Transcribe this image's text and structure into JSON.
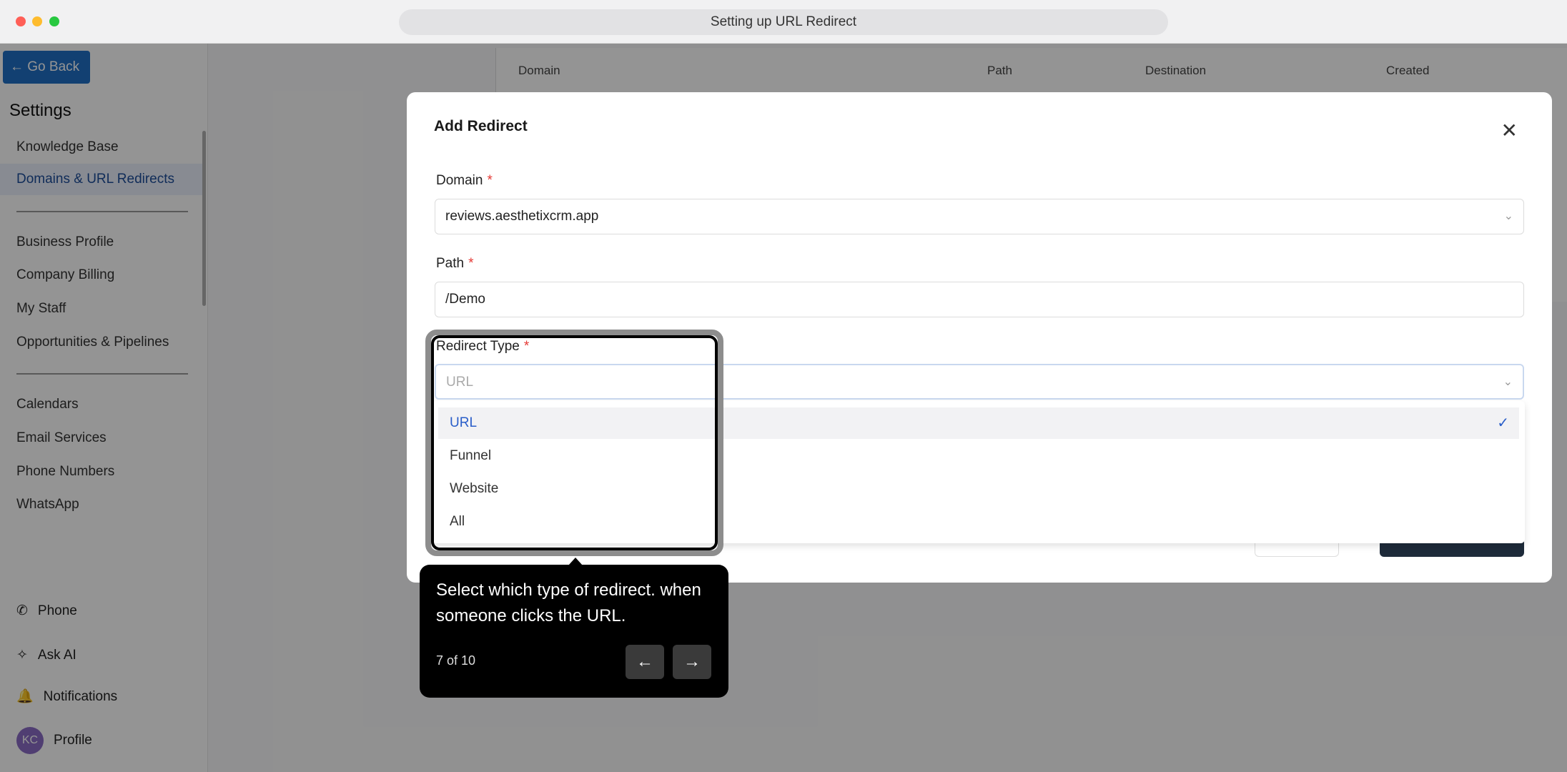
{
  "window": {
    "url_title": "Setting up URL Redirect"
  },
  "sidebar": {
    "go_back": "Go Back",
    "title": "Settings",
    "group1": [
      "Knowledge Base",
      "Domains & URL Redirects"
    ],
    "group2": [
      "Business Profile",
      "Company Billing",
      "My Staff",
      "Opportunities & Pipelines"
    ],
    "group3": [
      "Calendars",
      "Email Services",
      "Phone Numbers",
      "WhatsApp"
    ],
    "bottom": {
      "phone": "Phone",
      "ask_ai": "Ask AI",
      "notifications": "Notifications",
      "avatar_initials": "KC",
      "profile": "Profile"
    }
  },
  "table": {
    "headers": [
      "Domain",
      "Path",
      "Destination",
      "Created"
    ]
  },
  "modal": {
    "title": "Add Redirect",
    "domain_label": "Domain",
    "domain_value": "reviews.aesthetixcrm.app",
    "path_label": "Path",
    "path_value": "/Demo",
    "redirect_type_label": "Redirect Type",
    "redirect_type_placeholder": "URL",
    "required_mark": "*",
    "options": [
      "URL",
      "Funnel",
      "Website",
      "All"
    ],
    "selected_option": "URL"
  },
  "tooltip": {
    "text": "Select which type of redirect. when someone clicks the URL.",
    "step": "7 of 10"
  },
  "colors": {
    "accent": "#1f6fc4",
    "selected_option": "#2a5ec9",
    "required": "#e53935"
  }
}
